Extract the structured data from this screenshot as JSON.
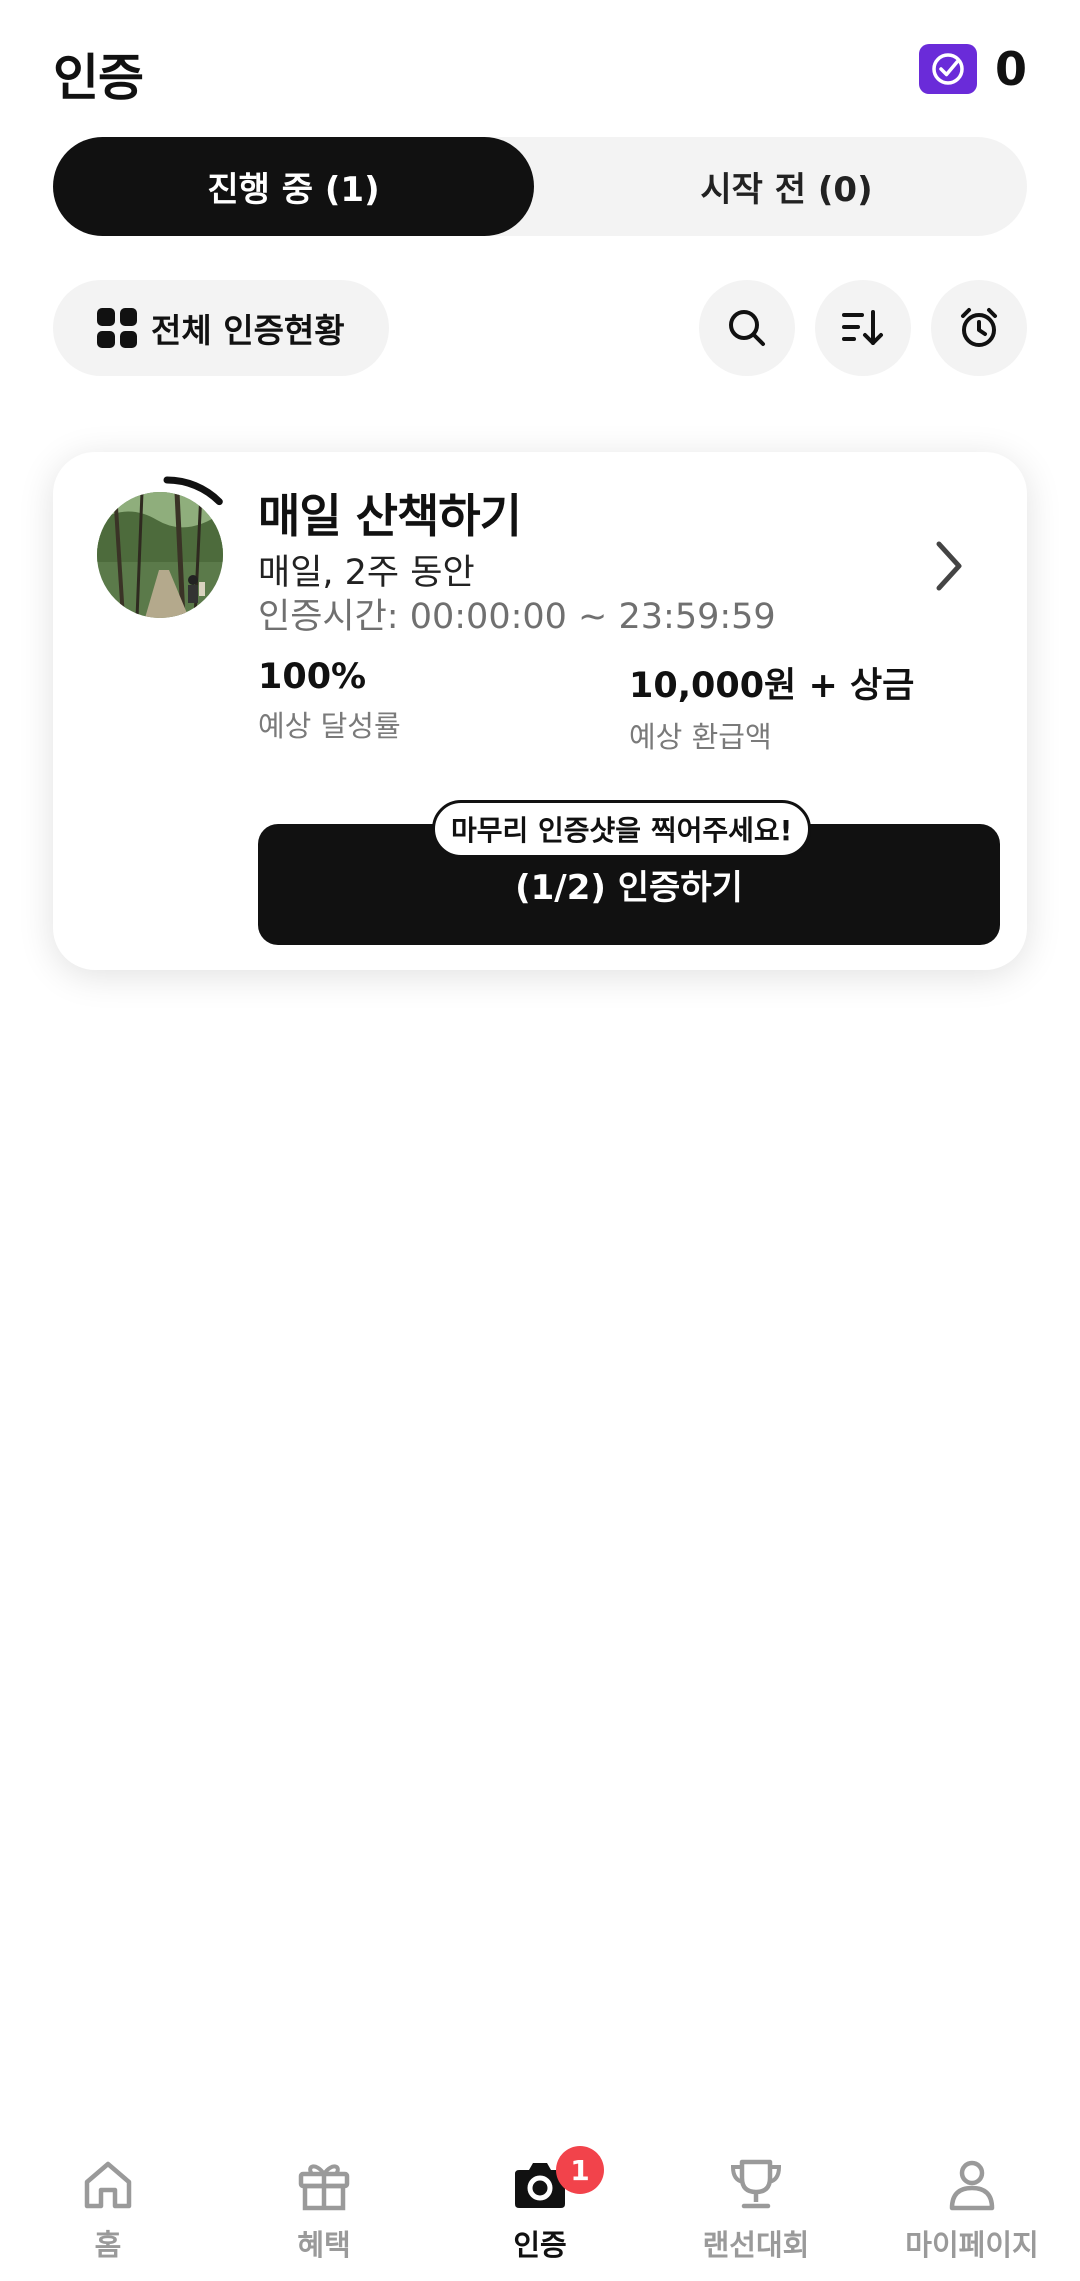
{
  "header": {
    "title": "인증",
    "points": "0",
    "points_icon": "check-badge-icon",
    "accent": "#6a2bd9"
  },
  "tabs": [
    {
      "label": "진행 중 (1)",
      "active": true
    },
    {
      "label": "시작 전 (0)",
      "active": false
    }
  ],
  "toolbar": {
    "status_label": "전체 인증현황",
    "icons": [
      "search-icon",
      "sort-icon",
      "alarm-icon"
    ]
  },
  "challenge": {
    "title": "매일 산책하기",
    "period": "매일, 2주 동안",
    "cert_time": "인증시간: 00:00:00 ~ 23:59:59",
    "rate_value": "100%",
    "rate_label": "예상 달성률",
    "refund_value": "10,000원 + 상금",
    "refund_label": "예상 환급액",
    "cta_label": "(1/2) 인증하기",
    "tooltip": "마무리 인증샷을 찍어주세요!",
    "progress": 0.125
  },
  "nav": {
    "items": [
      {
        "label": "홈",
        "icon": "home-icon",
        "active": false
      },
      {
        "label": "혜택",
        "icon": "gift-icon",
        "active": false
      },
      {
        "label": "인증",
        "icon": "camera-icon",
        "active": true
      },
      {
        "label": "랜선대회",
        "icon": "trophy-icon",
        "active": false
      },
      {
        "label": "마이페이지",
        "icon": "person-icon",
        "active": false
      }
    ],
    "badge": "1"
  }
}
